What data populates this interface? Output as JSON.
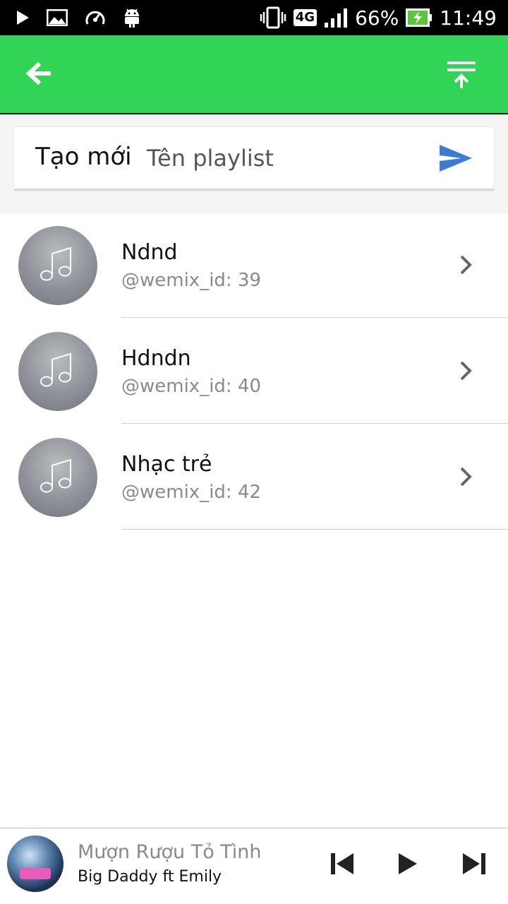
{
  "status_bar": {
    "battery": "66%",
    "time": "11:49",
    "network": "4G",
    "icons": [
      "play-icon",
      "image-icon",
      "speed-icon",
      "android-icon",
      "vibrate-icon",
      "signal-icon",
      "battery-charging-icon"
    ]
  },
  "app_bar": {
    "back_icon": "arrow-left-icon",
    "sort_icon": "move-to-top-icon",
    "color": "#32d458"
  },
  "create": {
    "label": "Tạo mới",
    "placeholder": "Tên playlist",
    "value": "",
    "send_icon": "send-icon",
    "send_color": "#3a7bd5"
  },
  "playlists": [
    {
      "title": "Ndnd",
      "subtitle": "@wemix_id: 39"
    },
    {
      "title": "Hdndn",
      "subtitle": "@wemix_id: 40"
    },
    {
      "title": "Nhạc trẻ",
      "subtitle": "@wemix_id: 42"
    }
  ],
  "player": {
    "song_title": "Mượn Rượu Tỏ Tình",
    "artist": "Big Daddy ft Emily",
    "icons": [
      "skip-previous-icon",
      "play-icon",
      "skip-next-icon"
    ]
  }
}
